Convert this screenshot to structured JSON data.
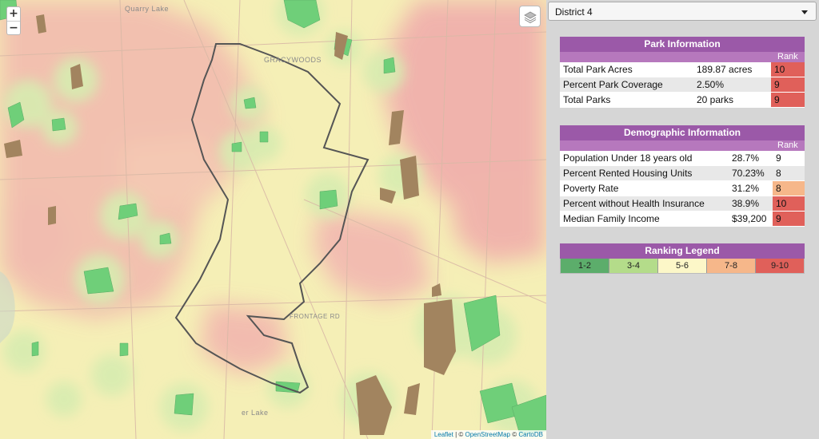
{
  "map": {
    "zoom_in": "+",
    "zoom_out": "−",
    "layers_icon": "layers-icon",
    "labels": {
      "quarry_lake": "Quarry Lake",
      "gracywoods": "GRACYWOODS",
      "frontage_rd": "FRONTAGE RD",
      "loyola_lake": "er Lake"
    },
    "attribution": {
      "leaflet": "Leaflet",
      "sep1": " | © ",
      "osm": "OpenStreetMap",
      "sep2": " © ",
      "carto": "CartoDB"
    }
  },
  "panel": {
    "district_select": "District 4",
    "park": {
      "title": "Park Information",
      "rank_header": "Rank",
      "rows": [
        {
          "label": "Total Park Acres",
          "value": "189.87 acres",
          "rank": "10",
          "color": "#e0605a"
        },
        {
          "label": "Percent Park Coverage",
          "value": "2.50%",
          "rank": "9",
          "color": "#e0605a"
        },
        {
          "label": "Total Parks",
          "value": "20 parks",
          "rank": "9",
          "color": "#e0605a"
        }
      ]
    },
    "demographic": {
      "title": "Demographic Information",
      "rank_header": "Rank",
      "rows": [
        {
          "label": "Population Under 18 years old",
          "value": "28.7%",
          "rank": "9",
          "color": ""
        },
        {
          "label": "Percent Rented Housing Units",
          "value": "70.23%",
          "rank": "8",
          "color": ""
        },
        {
          "label": "Poverty Rate",
          "value": "31.2%",
          "rank": "8",
          "color": "#f6b78a"
        },
        {
          "label": "Percent without Health Insurance",
          "value": "38.9%",
          "rank": "10",
          "color": "#e0605a"
        },
        {
          "label": "Median Family Income",
          "value": "$39,200",
          "rank": "9",
          "color": "#e0605a"
        }
      ]
    },
    "legend": {
      "title": "Ranking Legend",
      "items": [
        {
          "label": "1-2",
          "color": "#5cad6b"
        },
        {
          "label": "3-4",
          "color": "#b4dc8a"
        },
        {
          "label": "5-6",
          "color": "#fcf7c8"
        },
        {
          "label": "7-8",
          "color": "#f6b78a"
        },
        {
          "label": "9-10",
          "color": "#e0605a"
        }
      ]
    }
  }
}
